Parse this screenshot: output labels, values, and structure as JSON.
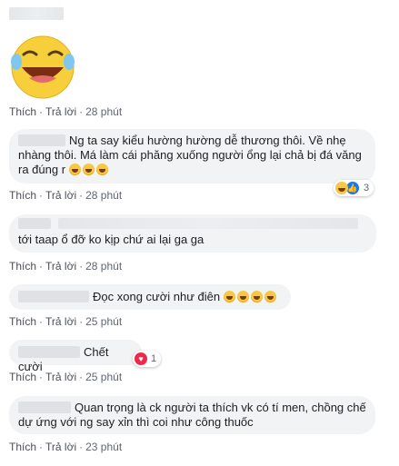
{
  "comments": [
    {
      "text": "",
      "actions": {
        "like": "Thích",
        "reply": "Trả lời",
        "time": "28 phút",
        "dot": "·"
      }
    },
    {
      "text": "Ng ta say kiểu hường hường dễ thương thôi. Về nhẹ nhàng thôi. Má làm cái phăng xuống người ổng lại chả bị đá văng ra đúng r",
      "actions": {
        "like": "Thích",
        "reply": "Trả lời",
        "time": "28 phút",
        "dot": "·"
      },
      "reactions": {
        "count": "3",
        "icons": [
          "laugh-icon",
          "like-icon"
        ]
      }
    },
    {
      "text": "tới taap ổ đỡ ko kịp chứ ai lại ga ga",
      "actions": {
        "like": "Thích",
        "reply": "Trả lời",
        "time": "28 phút",
        "dot": "·"
      }
    },
    {
      "text": "Đọc xong cười như điên",
      "actions": {
        "like": "Thích",
        "reply": "Trả lời",
        "time": "25 phút",
        "dot": "·"
      }
    },
    {
      "text": "Chết cười",
      "actions": {
        "like": "Thích",
        "reply": "Trả lời",
        "time": "25 phút",
        "dot": "·"
      },
      "reactions": {
        "count": "1",
        "icons": [
          "love-icon"
        ]
      }
    },
    {
      "text": "Quan trọng là ck người ta thích vk có tí men, chồng chế dự ứng với ng say xỉn thì coi như công thuốc",
      "actions": {
        "like": "Thích",
        "reply": "Trả lời",
        "time": "23 phút",
        "dot": "·"
      }
    }
  ],
  "colors": {
    "bubble": "#f2f3f5",
    "action_text": "#606770",
    "like_blue": "#1877f2",
    "love_red": "#f0284a"
  }
}
